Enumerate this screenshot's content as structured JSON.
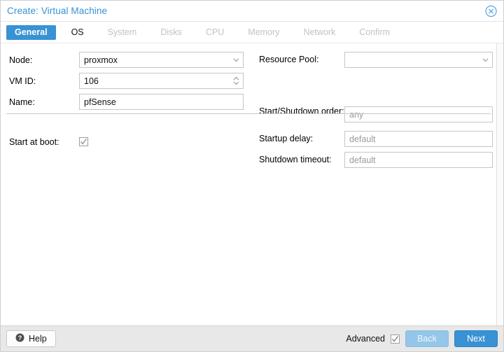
{
  "window": {
    "title": "Create: Virtual Machine",
    "close_icon": "close-circle-icon"
  },
  "tabs": [
    {
      "label": "General",
      "state": "active"
    },
    {
      "label": "OS",
      "state": "enabled"
    },
    {
      "label": "System",
      "state": "disabled"
    },
    {
      "label": "Disks",
      "state": "disabled"
    },
    {
      "label": "CPU",
      "state": "disabled"
    },
    {
      "label": "Memory",
      "state": "disabled"
    },
    {
      "label": "Network",
      "state": "disabled"
    },
    {
      "label": "Confirm",
      "state": "disabled"
    }
  ],
  "form": {
    "node": {
      "label": "Node:",
      "value": "proxmox",
      "icon": "chevron-down-icon"
    },
    "vmid": {
      "label": "VM ID:",
      "value": "106",
      "icon": "spinner-updown-icon"
    },
    "name": {
      "label": "Name:",
      "value": "pfSense"
    },
    "resource_pool": {
      "label": "Resource Pool:",
      "value": "",
      "icon": "chevron-down-icon"
    },
    "start_at_boot": {
      "label": "Start at boot:",
      "checked": true
    },
    "start_shutdown_order": {
      "label": "Start/Shutdown order:",
      "placeholder": "any",
      "value": ""
    },
    "startup_delay": {
      "label": "Startup delay:",
      "placeholder": "default",
      "value": ""
    },
    "shutdown_timeout": {
      "label": "Shutdown timeout:",
      "placeholder": "default",
      "value": ""
    }
  },
  "footer": {
    "help_label": "Help",
    "help_icon": "question-circle-icon",
    "advanced_label": "Advanced",
    "advanced_checked": true,
    "back_label": "Back",
    "back_disabled": true,
    "next_label": "Next"
  },
  "colors": {
    "accent": "#3892d4",
    "accent_faded": "#93c6e8",
    "footer_bg": "#e8e8e8",
    "placeholder": "#9a9a9a",
    "disabled_tab": "#c2c2c2"
  }
}
